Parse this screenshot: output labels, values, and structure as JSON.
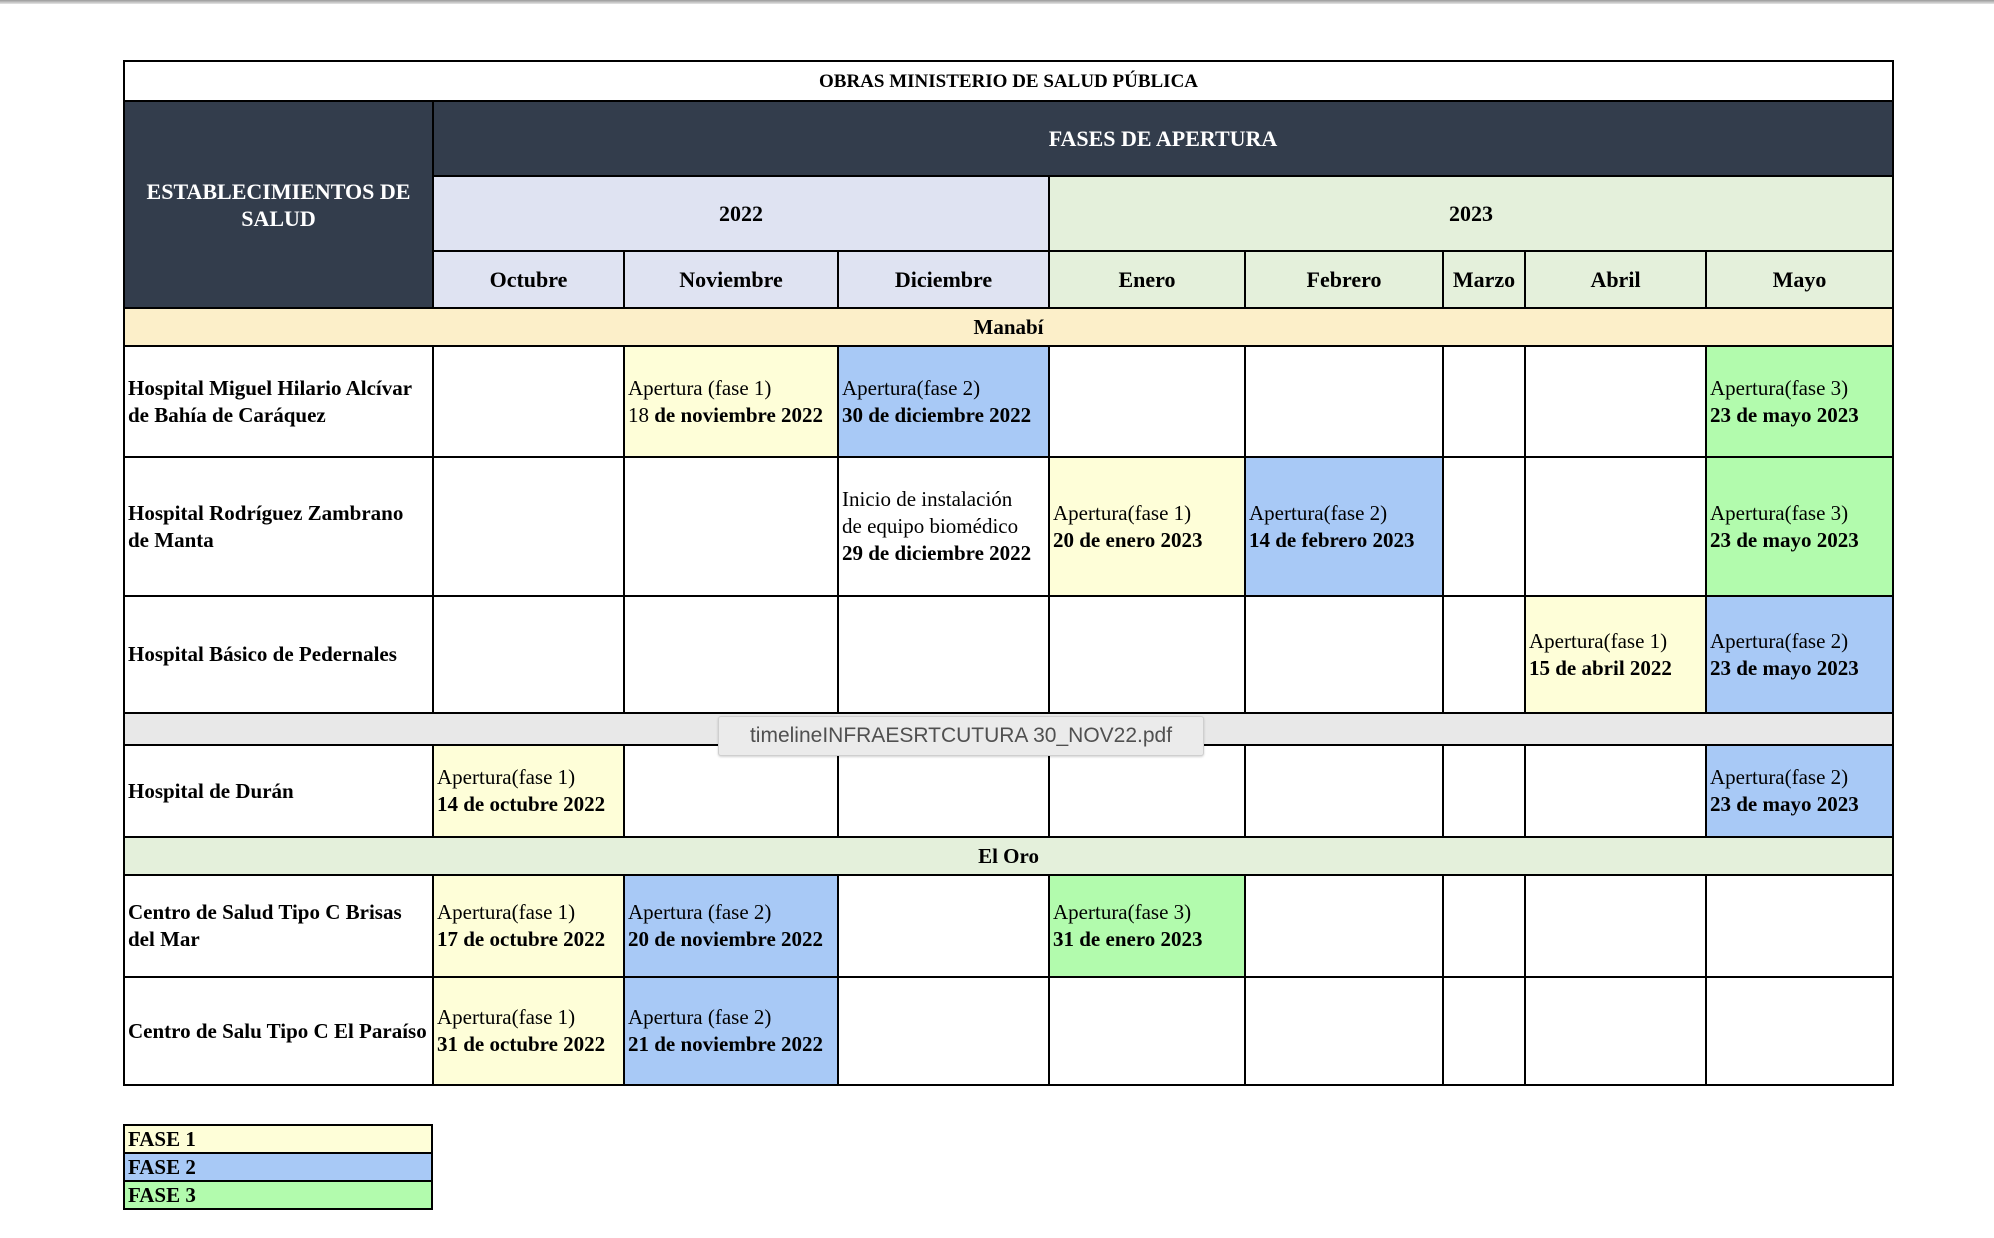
{
  "document": {
    "title": "OBRAS MINISTERIO DE SALUD PÚBLICA",
    "corner_header": "ESTABLECIMIENTOS DE SALUD",
    "phases_header": "FASES DE APERTURA",
    "years": [
      "2022",
      "2023"
    ],
    "months": [
      "Octubre",
      "Noviembre",
      "Diciembre",
      "Enero",
      "Febrero",
      "Marzo",
      "Abril",
      "Mayo"
    ]
  },
  "regions": {
    "manabi": "Manabí",
    "guayas": "",
    "el_oro": "El Oro"
  },
  "rows": [
    {
      "name": "Hospital Miguel Hilario Alcívar de Bahía de Caráquez",
      "nov": {
        "line1": "Apertura (fase 1)",
        "date_prefix": "18 ",
        "date": "de noviembre 2022"
      },
      "dic": {
        "line1": "Apertura(fase 2)",
        "date": "30 de diciembre 2022"
      },
      "may": {
        "line1": "Apertura(fase 3)",
        "date": "23 de mayo 2023"
      }
    },
    {
      "name": "Hospital Rodríguez Zambrano de Manta",
      "dic": {
        "line1": "Inicio de instalación",
        "line2": "de equipo biomédico",
        "date": "29 de diciembre 2022"
      },
      "ene": {
        "line1": "Apertura(fase 1)",
        "date": "20 de enero 2023"
      },
      "feb": {
        "line1": "Apertura(fase 2)",
        "date": "14 de febrero 2023"
      },
      "may": {
        "line1": "Apertura(fase 3)",
        "date": "23 de mayo 2023"
      }
    },
    {
      "name": "Hospital Básico de Pedernales",
      "abr": {
        "line1": "Apertura(fase 1)",
        "date": "15 de abril 2022"
      },
      "may": {
        "line1": "Apertura(fase 2)",
        "date": "23 de mayo 2023"
      }
    },
    {
      "name": "Hospital de Durán",
      "oct": {
        "line1": "Apertura(fase 1)",
        "date": "14 de octubre 2022"
      },
      "may": {
        "line1": "Apertura(fase 2)",
        "date": "23 de mayo 2023"
      }
    },
    {
      "name": "Centro de Salud Tipo C  Brisas del Mar",
      "oct": {
        "line1": "Apertura(fase 1)",
        "date": "17 de octubre 2022"
      },
      "nov": {
        "line1": "Apertura (fase 2)",
        "date": "20 de noviembre 2022"
      },
      "ene": {
        "line1": "Apertura(fase 3)",
        "date": "31 de enero 2023"
      }
    },
    {
      "name": "Centro de Salu Tipo C El Paraíso",
      "oct": {
        "line1": "Apertura(fase 1)",
        "date": "31 de octubre 2022"
      },
      "nov": {
        "line1": "Apertura (fase 2)",
        "date": "21 de noviembre 2022"
      }
    }
  ],
  "legend": [
    "FASE 1",
    "FASE 2",
    "FASE 3"
  ],
  "overlay": {
    "filename": "timelineINFRAESRTCUTURA 30_NOV22.pdf"
  },
  "colors": {
    "header_dark": "#333d4c",
    "year_2022": "#dfe3f2",
    "year_2023": "#e4f0db",
    "fase1": "#fefed8",
    "fase2": "#a8c9f6",
    "fase3": "#b2fbad",
    "region_manabi": "#fcefc9",
    "region_el_oro": "#e4f0db"
  }
}
